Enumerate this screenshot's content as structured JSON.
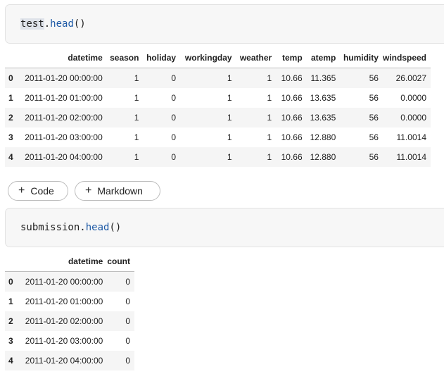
{
  "cell1": {
    "code_obj": "test",
    "code_dot": ".",
    "code_fn": "head",
    "code_parens": "()"
  },
  "table1": {
    "columns": [
      "",
      "datetime",
      "season",
      "holiday",
      "workingday",
      "weather",
      "temp",
      "atemp",
      "humidity",
      "windspeed"
    ],
    "rows": [
      [
        "0",
        "2011-01-20 00:00:00",
        "1",
        "0",
        "1",
        "1",
        "10.66",
        "11.365",
        "56",
        "26.0027"
      ],
      [
        "1",
        "2011-01-20 01:00:00",
        "1",
        "0",
        "1",
        "1",
        "10.66",
        "13.635",
        "56",
        "0.0000"
      ],
      [
        "2",
        "2011-01-20 02:00:00",
        "1",
        "0",
        "1",
        "1",
        "10.66",
        "13.635",
        "56",
        "0.0000"
      ],
      [
        "3",
        "2011-01-20 03:00:00",
        "1",
        "0",
        "1",
        "1",
        "10.66",
        "12.880",
        "56",
        "11.0014"
      ],
      [
        "4",
        "2011-01-20 04:00:00",
        "1",
        "0",
        "1",
        "1",
        "10.66",
        "12.880",
        "56",
        "11.0014"
      ]
    ]
  },
  "buttons": {
    "code_label": "Code",
    "markdown_label": "Markdown",
    "plus": "+"
  },
  "cell2": {
    "code_obj": "submission",
    "code_dot": ".",
    "code_fn": "head",
    "code_parens": "()"
  },
  "table2": {
    "columns": [
      "",
      "datetime",
      "count"
    ],
    "rows": [
      [
        "0",
        "2011-01-20 00:00:00",
        "0"
      ],
      [
        "1",
        "2011-01-20 01:00:00",
        "0"
      ],
      [
        "2",
        "2011-01-20 02:00:00",
        "0"
      ],
      [
        "3",
        "2011-01-20 03:00:00",
        "0"
      ],
      [
        "4",
        "2011-01-20 04:00:00",
        "0"
      ]
    ]
  },
  "colors": {
    "function_color": "#1e5aa6",
    "stripe": "#f5f5f5",
    "cell_bg": "#f7f7f7"
  }
}
